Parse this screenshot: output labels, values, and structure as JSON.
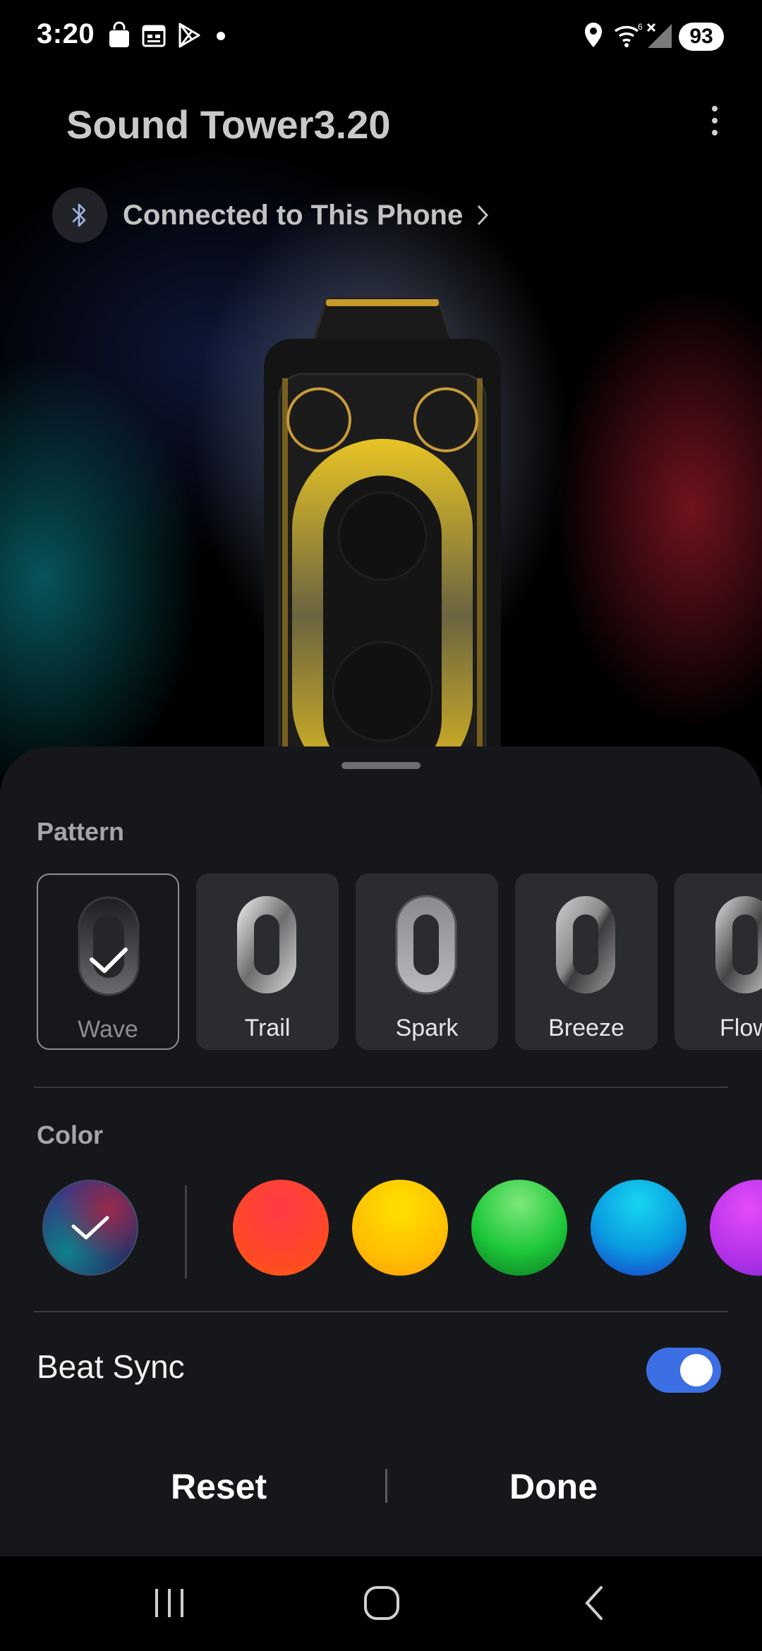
{
  "status_bar": {
    "time": "3:20",
    "battery": "93",
    "icons": [
      "shopping-bag-icon",
      "calendar-icon",
      "play-store-icon",
      "notification-dot-icon",
      "location-icon",
      "wifi-icon",
      "signal-icon",
      "battery-icon"
    ]
  },
  "header": {
    "title": "Sound Tower3.20",
    "connection": "Connected to This Phone"
  },
  "sheet": {
    "pattern_label": "Pattern",
    "patterns": [
      {
        "label": "Wave",
        "selected": true
      },
      {
        "label": "Trail",
        "selected": false
      },
      {
        "label": "Spark",
        "selected": false
      },
      {
        "label": "Breeze",
        "selected": false
      },
      {
        "label": "Flow",
        "selected": false
      }
    ],
    "color_label": "Color",
    "colors": [
      {
        "name": "multicolor",
        "selected": true
      },
      {
        "name": "red",
        "hex": "#ff2f2f"
      },
      {
        "name": "yellow",
        "hex": "#ffc400"
      },
      {
        "name": "green",
        "hex": "#1ec83a"
      },
      {
        "name": "blue",
        "hex": "#0aa6e6"
      },
      {
        "name": "purple",
        "hex": "#c83cf0"
      }
    ],
    "beat_sync_label": "Beat Sync",
    "beat_sync_on": true,
    "reset_label": "Reset",
    "done_label": "Done"
  },
  "colors": {
    "accent": "#3c6fe3",
    "sheet_bg": "#16171a",
    "ring_yellow": "#d9b21a"
  }
}
